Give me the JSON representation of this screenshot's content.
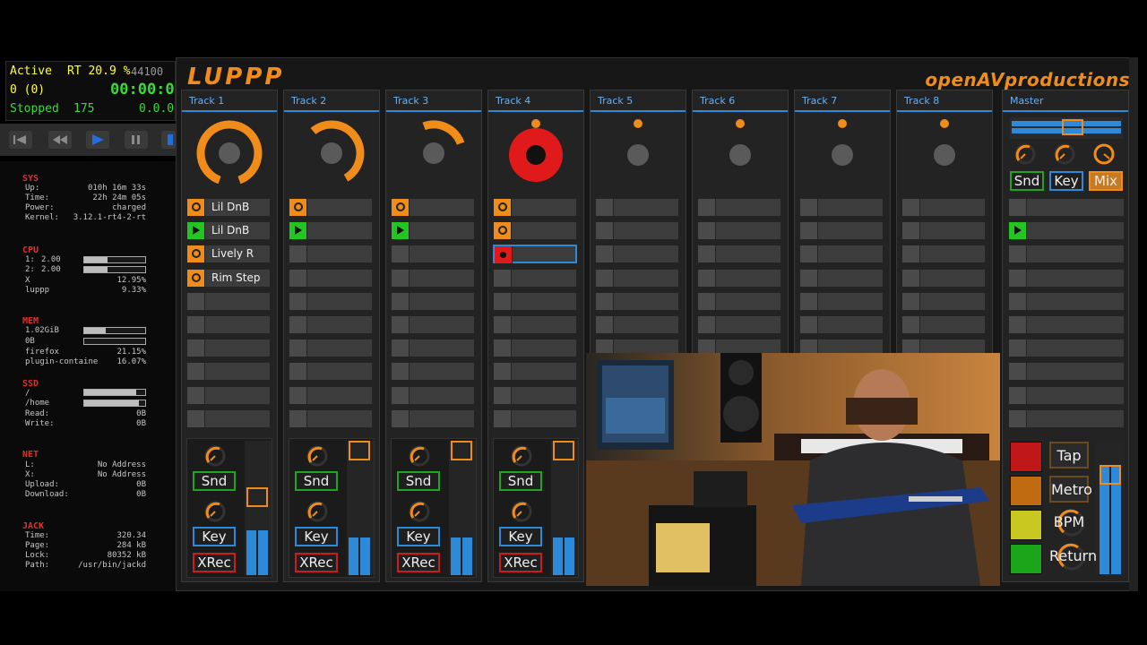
{
  "transport": {
    "status": "Active",
    "rt": "RT 20.9 %",
    "samplerate": "44100",
    "xruns": "0 (0)",
    "time": "00:00:0",
    "state": "Stopped",
    "frames": "175",
    "bbt": "0.0.0"
  },
  "conky": {
    "sys": {
      "heading": "SYS",
      "rows": [
        [
          "Up:",
          "010h 16m 33s"
        ],
        [
          "Time:",
          "22h 24m 05s"
        ],
        [
          "Power:",
          "charged"
        ],
        [
          "Kernel:",
          "3.12.1-rt4-2-rt"
        ]
      ]
    },
    "cpu": {
      "heading": "CPU",
      "rows": [
        [
          "1:",
          "2.00"
        ],
        [
          "2:",
          "2.00"
        ],
        [
          "X",
          "12.95%"
        ],
        [
          "luppp",
          "9.33%"
        ]
      ],
      "bars": [
        0.38,
        0.38
      ]
    },
    "mem": {
      "heading": "MEM",
      "rows": [
        [
          "1.02GiB",
          ""
        ],
        [
          "0B",
          ""
        ],
        [
          "firefox",
          "21.15%"
        ],
        [
          "plugin-containe",
          "16.07%"
        ]
      ],
      "bars": [
        0.35,
        0.0
      ]
    },
    "ssd": {
      "heading": "SSD",
      "rows": [
        [
          "/",
          ""
        ],
        [
          "/home",
          ""
        ],
        [
          "Read:",
          "0B"
        ],
        [
          "Write:",
          "0B"
        ]
      ],
      "bars": [
        0.85,
        0.9
      ]
    },
    "net": {
      "heading": "NET",
      "rows": [
        [
          "L:",
          "No Address"
        ],
        [
          "X:",
          "No Address"
        ],
        [
          "Upload:",
          "0B"
        ],
        [
          "Download:",
          "0B"
        ]
      ]
    },
    "jack": {
      "heading": "JACK",
      "rows": [
        [
          "Time:",
          "320.34"
        ],
        [
          "Page:",
          "284 kB"
        ],
        [
          "Lock:",
          "80352 kB"
        ],
        [
          "Path:",
          "/usr/bin/jackd"
        ]
      ]
    }
  },
  "app": {
    "logo": "LUPPP",
    "brand": "openAVproductions",
    "colors": {
      "accent": "#f08c1a",
      "blue": "#2c8ad8",
      "green": "#22c522",
      "red": "#e01a1a"
    }
  },
  "tracks": [
    {
      "name": "Track 1",
      "clips": [
        [
          "orange",
          "Lil DnB"
        ],
        [
          "green",
          "Lil DnB"
        ],
        [
          "orange",
          "Lively R"
        ],
        [
          "orange",
          "Rim Step"
        ]
      ]
    },
    {
      "name": "Track 2",
      "clips": [
        [
          "orange",
          ""
        ],
        [
          "green",
          ""
        ]
      ]
    },
    {
      "name": "Track 3",
      "clips": [
        [
          "orange",
          ""
        ],
        [
          "green",
          ""
        ]
      ]
    },
    {
      "name": "Track 4",
      "clips": [
        [
          "orange",
          ""
        ],
        [
          "orange",
          ""
        ],
        [
          "red",
          ""
        ]
      ]
    },
    {
      "name": "Track 5",
      "clips": []
    },
    {
      "name": "Track 6",
      "clips": []
    },
    {
      "name": "Track 7",
      "clips": []
    },
    {
      "name": "Track 8",
      "clips": []
    }
  ],
  "mixer": {
    "snd": "Snd",
    "key": "Key",
    "xrec": "XRec"
  },
  "master": {
    "name": "Master",
    "snd": "Snd",
    "key": "Key",
    "mix": "Mix",
    "tap": "Tap",
    "metro": "Metro",
    "bpm": "BPM",
    "return": "Return"
  }
}
